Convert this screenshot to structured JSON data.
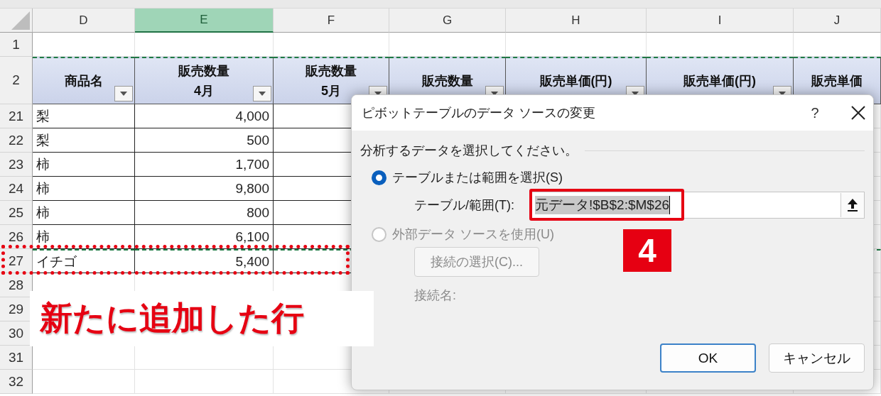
{
  "sheet": {
    "columns": [
      {
        "label": "D",
        "selected": false
      },
      {
        "label": "E",
        "selected": true
      },
      {
        "label": "F",
        "selected": false
      },
      {
        "label": "G",
        "selected": false
      },
      {
        "label": "H",
        "selected": false
      },
      {
        "label": "I",
        "selected": false
      },
      {
        "label": "J",
        "selected": false
      }
    ],
    "rows": [
      {
        "number": "1",
        "kind": "blank"
      },
      {
        "number": "2",
        "kind": "header",
        "cells": [
          {
            "lines": [
              "商品名"
            ],
            "filter": true
          },
          {
            "lines": [
              "販売数量",
              "4月"
            ],
            "filter": true
          },
          {
            "lines": [
              "販売数量",
              "5月"
            ],
            "filter": true
          },
          {
            "lines": [
              "販売数量"
            ],
            "filter": true
          },
          {
            "lines": [
              "販売単価(円)"
            ],
            "filter": true
          },
          {
            "lines": [
              "販売単価(円)"
            ],
            "filter": true
          },
          {
            "lines": [
              "販売単価"
            ],
            "filter": false
          }
        ]
      },
      {
        "number": "21",
        "kind": "data",
        "cells": [
          "梨",
          "4,000"
        ]
      },
      {
        "number": "22",
        "kind": "data",
        "cells": [
          "梨",
          "500"
        ]
      },
      {
        "number": "23",
        "kind": "data",
        "cells": [
          "柿",
          "1,700"
        ]
      },
      {
        "number": "24",
        "kind": "data",
        "cells": [
          "柿",
          "9,800"
        ]
      },
      {
        "number": "25",
        "kind": "data",
        "cells": [
          "柿",
          "800"
        ]
      },
      {
        "number": "26",
        "kind": "data",
        "cells": [
          "柿",
          "6,100"
        ]
      },
      {
        "number": "27",
        "kind": "data",
        "cells": [
          "イチゴ",
          "5,400"
        ]
      },
      {
        "number": "28",
        "kind": "blank"
      },
      {
        "number": "29",
        "kind": "blank"
      },
      {
        "number": "30",
        "kind": "blank"
      },
      {
        "number": "31",
        "kind": "blank"
      },
      {
        "number": "32",
        "kind": "blank"
      }
    ]
  },
  "dialog": {
    "title": "ピボットテーブルのデータ ソースの変更",
    "help": "?",
    "prompt": "分析するデータを選択してください。",
    "options": [
      {
        "label": "テーブルまたは範囲を選択(S)",
        "selected": true,
        "disabled": false
      },
      {
        "label": "外部データ ソースを使用(U)",
        "selected": false,
        "disabled": true
      }
    ],
    "range_label": "テーブル/範囲(T):",
    "range_value": "元データ!$B$2:$M$26",
    "connection_button": {
      "label": "接続の選択(C)...",
      "disabled": true
    },
    "connection_label": "接続名:",
    "buttons": [
      {
        "label": "OK",
        "default": true
      },
      {
        "label": "キャンセル",
        "default": false
      }
    ]
  },
  "annotations": {
    "badge": "4",
    "callout": "新たに追加した行"
  }
}
